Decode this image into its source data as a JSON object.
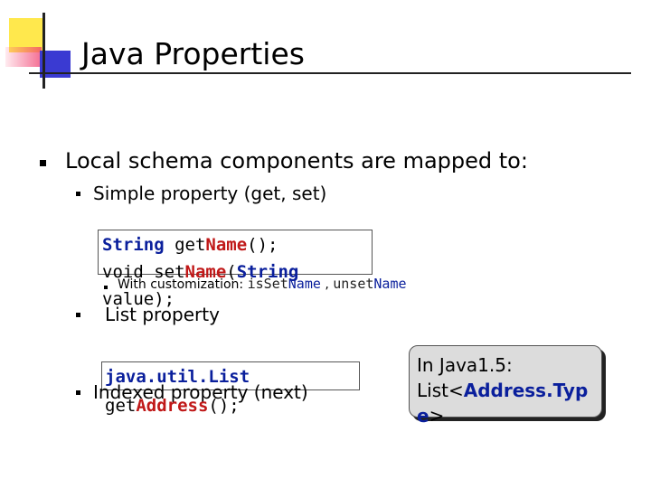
{
  "slide": {
    "title": "Java Properties",
    "bullet1": "Local schema components are mapped to:",
    "sub1": "Simple property (get, set)",
    "code1": {
      "line1_type": "String",
      "line1_get": " get",
      "line1_name": "Name",
      "line1_end": "();",
      "line2_void": "void set",
      "line2_name": "Name",
      "line2_paren": "(",
      "line2_type": "String",
      "line3": "value);"
    },
    "customization": {
      "label": "With customization:",
      "isset_prefix": "isSet",
      "isset_name": "Name",
      "separator": " , ",
      "unset_prefix": "unset",
      "unset_name": "Name"
    },
    "sub2": "List property",
    "sub3": "Indexed property (next)",
    "code2": {
      "line1": "java.util.List",
      "line2_get": "get",
      "line2_name": "Address",
      "line2_end": "();"
    },
    "callout": {
      "line1": "In Java1.5:",
      "line2_prefix": "List<",
      "line2_type": "Address.Typ",
      "line3_type": "e",
      "line3_end": ">"
    }
  }
}
